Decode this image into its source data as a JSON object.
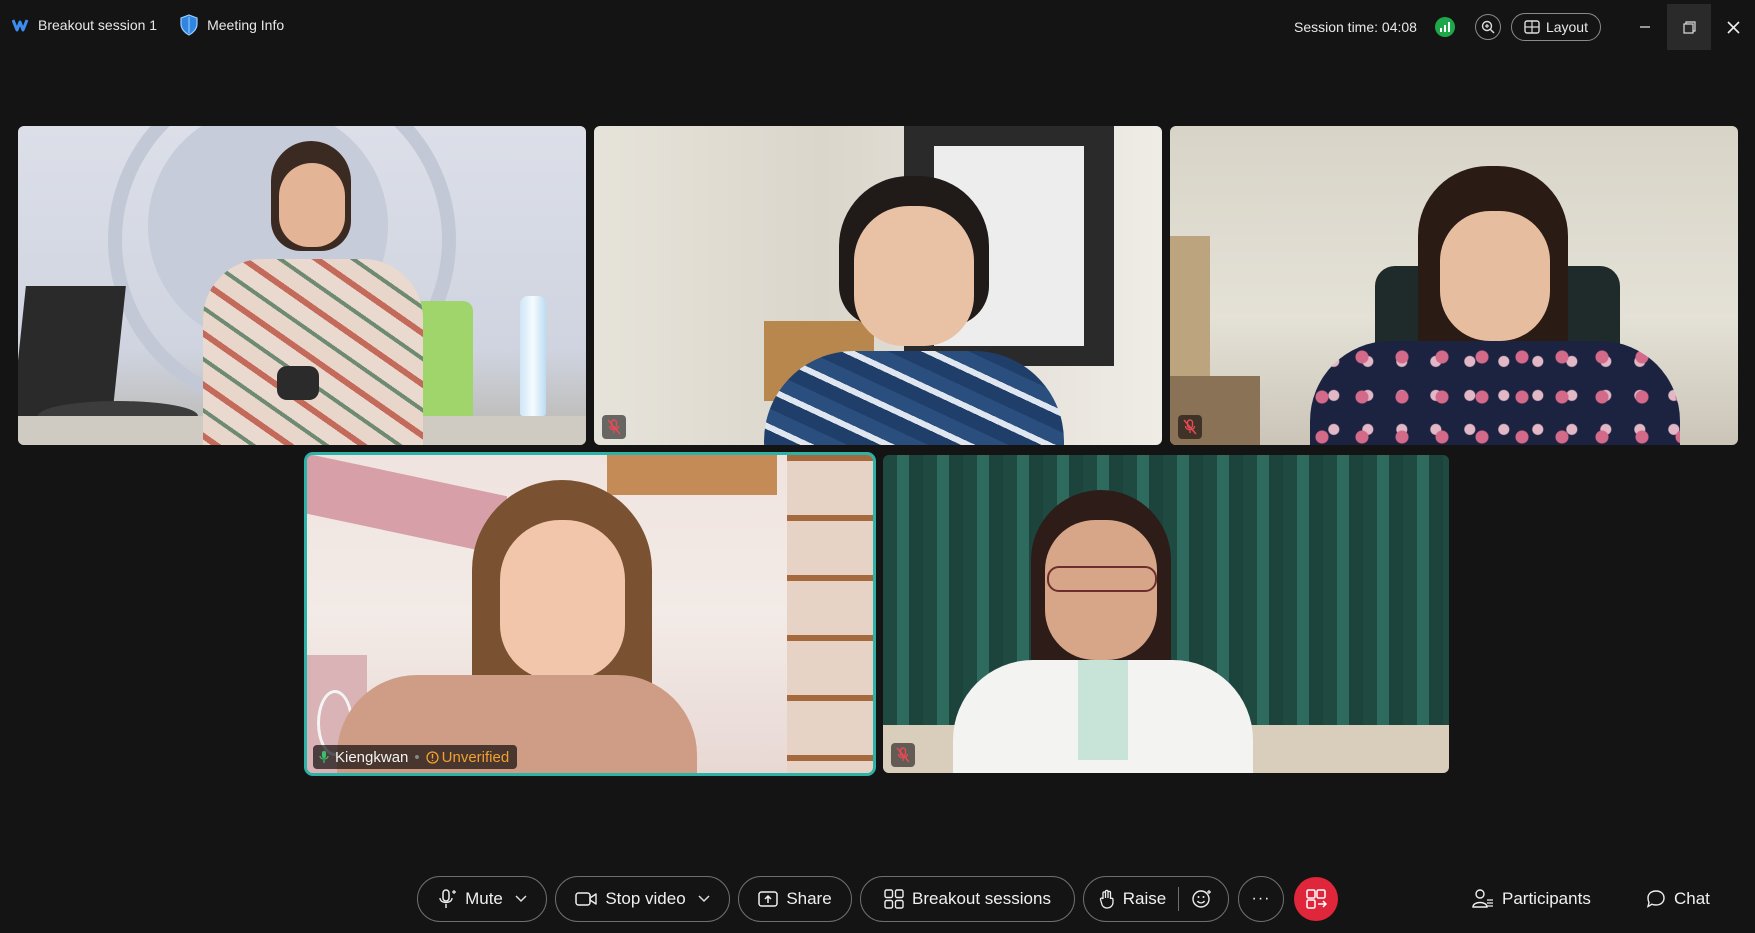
{
  "window": {
    "session_name": "Breakout session 1",
    "meeting_info": "Meeting Info",
    "session_time": "Session time: 04:08",
    "layout_label": "Layout"
  },
  "participants": [
    {
      "id": "p1",
      "muted": false,
      "name": ""
    },
    {
      "id": "p2",
      "muted": true,
      "name": ""
    },
    {
      "id": "p3",
      "muted": true,
      "name": ""
    },
    {
      "id": "p4",
      "muted": false,
      "name": "Kiengkwan",
      "badge": "Unverified",
      "active_speaker": true
    },
    {
      "id": "p5",
      "muted": true,
      "name": ""
    }
  ],
  "toolbar": {
    "mute": "Mute",
    "stop_video": "Stop video",
    "share": "Share",
    "breakout": "Breakout sessions",
    "raise": "Raise",
    "more": "···",
    "participants": "Participants",
    "chat": "Chat"
  },
  "colors": {
    "background": "#141414",
    "active_border": "#2bb3a8",
    "leave_button": "#e0263a",
    "signal": "#1fa84a",
    "unverified": "#f2a12f"
  }
}
